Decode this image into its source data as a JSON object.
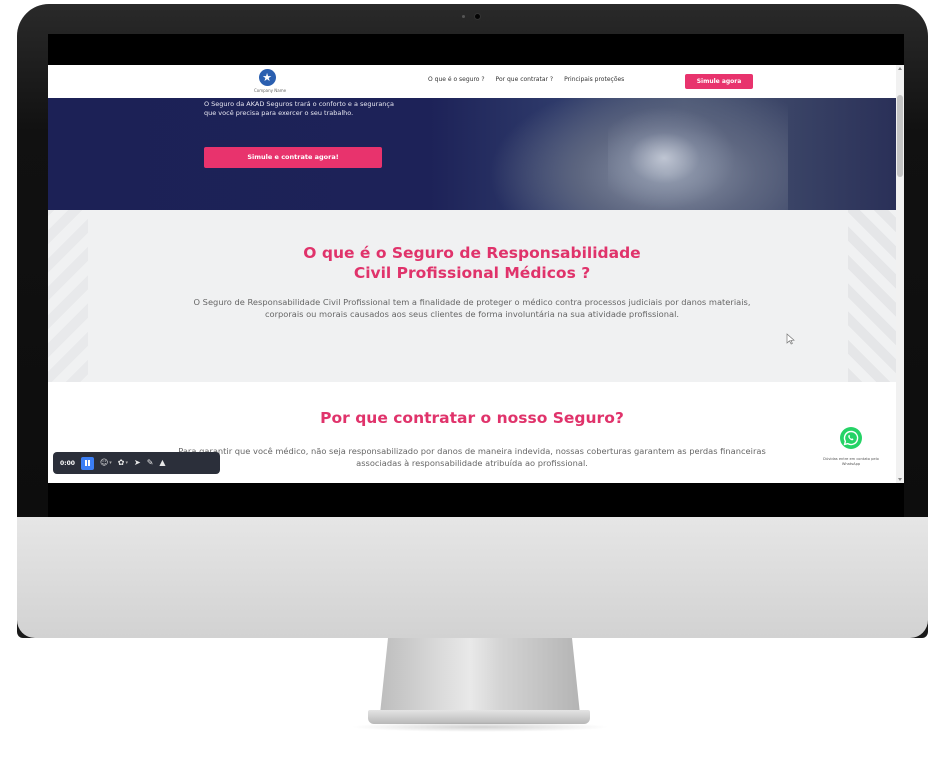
{
  "header": {
    "logo_text": "Company Name",
    "nav": [
      {
        "label": "O que é o seguro ?"
      },
      {
        "label": "Por que contratar ?"
      },
      {
        "label": "Principais proteções"
      }
    ],
    "cta_label": "Simule agora"
  },
  "hero": {
    "text": "O Seguro da AKAD Seguros trará o conforto e a segurança que você precisa para exercer o seu trabalho.",
    "button_label": "Simule e contrate agora!"
  },
  "section_what": {
    "title_line1": "O que é o Seguro de Responsabilidade",
    "title_line2": "Civil Profissional Médicos ?",
    "body": "O Seguro de Responsabilidade Civil Profissional tem a finalidade de proteger o médico contra processos judiciais por danos materiais, corporais ou morais causados aos seus clientes de forma involuntária na sua atividade profissional."
  },
  "section_why": {
    "title": "Por que contratar o nosso Seguro?",
    "body": "Para garantir que você médico, não seja responsabilizado por danos de maneira indevida, nossas coberturas garantem as perdas financeiras associadas à responsabilidade atribuída ao profissional."
  },
  "whatsapp": {
    "label": "Dúvidas entre em contato pelo WhatsApp",
    "icon": "whatsapp-icon",
    "color": "#25d366"
  },
  "recorder": {
    "time": "0:00",
    "tools": [
      "pause-icon",
      "emoji-icon",
      "sticker-icon",
      "pointer-icon",
      "pen-icon",
      "highlighter-icon"
    ]
  },
  "colors": {
    "accent": "#e8336d",
    "hero_bg": "#1c2156"
  }
}
